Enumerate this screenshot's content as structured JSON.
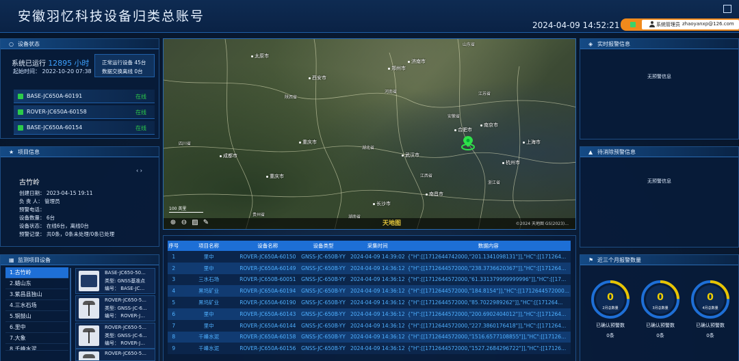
{
  "header": {
    "title": "安徽羽忆科技设备归类总账号",
    "datetime": "2024-04-09 14:52:21",
    "user_role": "系统管理员",
    "user_email": "zhaoyanxp@126.com"
  },
  "device_status": {
    "title": "设备状态",
    "running_label": "系统已运行",
    "running_hours": "12895",
    "running_unit": "小时",
    "start_label": "起始时间：",
    "start_value": "2022-10-20 07:38",
    "normal_label": "正常运行设备 45台",
    "offline_label": "数据交换离线 0台",
    "devices": [
      {
        "name": "BASE-JC650A-60191",
        "status": "在线"
      },
      {
        "name": "ROVER-JC650A-60158",
        "status": "在线"
      },
      {
        "name": "BASE-JC650A-60154",
        "status": "在线"
      }
    ]
  },
  "project_info": {
    "title": "项目信息",
    "name": "古竹岭",
    "create_date": "创建日期：  2023-04-15 19:11",
    "owner": "负 责 人：  管理员",
    "phone": "预警电话：",
    "device_count": "设备数量：  6台",
    "device_status": "设备状态：  在线6台，离线0台",
    "alarm_record": "预警记录：  共0条，0条未处理/0条已处理"
  },
  "monitor": {
    "title": "监测项目设备",
    "items": [
      "1.古竹岭",
      "2.蜡山东",
      "3.紫昌县独山",
      "4.三水石场",
      "5.铜鼓山",
      "6.里中",
      "7.大象",
      "8.千峰水泥"
    ],
    "cards": [
      {
        "name": "BASE-JC650-50...",
        "type": "类型: GNSS基准点",
        "code": "编号：  BASE-JC..."
      },
      {
        "name": "ROVER-JC650-5...",
        "type": "类型: GNSS-JC-6...",
        "code": "编号：  ROVER-J..."
      },
      {
        "name": "ROVER-JC650-5...",
        "type": "类型: GNSS-JC-6...",
        "code": "编号：  ROVER-J..."
      },
      {
        "name": "ROVER-JC650-5...",
        "type": "",
        "code": ""
      }
    ]
  },
  "map": {
    "scale": "100 英里",
    "logo": "天地图",
    "copyright": "©2024 天地图 GS(2023)...",
    "cities": [
      "郑州市",
      "西安市",
      "合肥市",
      "南京市",
      "上海市",
      "武汉市",
      "成都市",
      "重庆市",
      "杭州市",
      "长沙市",
      "南昌市",
      "太原市",
      "济南市"
    ],
    "provinces": [
      "河南省",
      "陕西省",
      "湖北省",
      "安徽省",
      "江苏省",
      "四川省",
      "重庆市",
      "湖南省",
      "江西省",
      "浙江省",
      "贵州省",
      "山东省"
    ]
  },
  "table": {
    "headers": [
      "序号",
      "项目名称",
      "设备名称",
      "设备类型",
      "采集时间",
      "数据内容"
    ],
    "rows": [
      [
        "1",
        "里中",
        "ROVER-JC650A-60150",
        "GNSS-JC-650B-YY",
        "2024-04-09 14:39:02",
        "{\"H\":[[1712644742000,\"201.1341098131\"]],\"HC\":[[171264..."
      ],
      [
        "2",
        "里中",
        "ROVER-JC650A-60149",
        "GNSS-JC-650B-YY",
        "2024-04-09 14:36:12",
        "{\"H\":[[1712644572000,\"238.3736620367\"]],\"HC\":[[171264..."
      ],
      [
        "3",
        "三水石场",
        "ROVER-JC650B-60051",
        "GNSS-JC-650B-YY",
        "2024-04-09 14:36:12",
        "{\"H\":[[1712644572000,\"61.331379999999996\"]],\"HC\":[[17..."
      ],
      [
        "4",
        "黑坞矿业",
        "ROVER-JC650A-60194",
        "GNSS-JC-650B-YY",
        "2024-04-09 14:36:12",
        "{\"H\":[[1712644572000,\"184.8154\"]],\"HC\":[[1712644572000..."
      ],
      [
        "5",
        "黑坞矿业",
        "ROVER-JC650A-60190",
        "GNSS-JC-650B-YY",
        "2024-04-09 14:36:12",
        "{\"H\":[[1712644572000,\"85.7022989262\"]],\"HC\":[[171264..."
      ],
      [
        "6",
        "里中",
        "ROVER-JC650A-60143",
        "GNSS-JC-650B-YY",
        "2024-04-09 14:36:12",
        "{\"H\":[[1712644572000,\"200.6902404012\"]],\"HC\":[[171264..."
      ],
      [
        "7",
        "里中",
        "ROVER-JC650A-60144",
        "GNSS-JC-650B-YY",
        "2024-04-09 14:36:12",
        "{\"H\":[[1712644572000,\"227.3860176418\"]],\"HC\":[[171264..."
      ],
      [
        "8",
        "千峰水泥",
        "ROVER-JC650A-60158",
        "GNSS-JC-650B-YY",
        "2024-04-09 14:36:12",
        "{\"H\":[[1712644572000,\"1516.6577108855\"]],\"HC\":[[17126..."
      ],
      [
        "9",
        "千峰水泥",
        "ROVER-JC650A-60156",
        "GNSS-JC-650B-YY",
        "2024-04-09 14:36:12",
        "{\"H\":[[1712644572000,\"1527.2684296722\"]],\"HC\":[[17126..."
      ]
    ]
  },
  "realtime_alarm": {
    "title": "实时报警信息",
    "empty": "无预警信息"
  },
  "pending_alarm": {
    "title": "待消除预警信息",
    "empty": "无预警信息"
  },
  "three_month": {
    "title": "近三个月报警数量",
    "rings": [
      {
        "value": "0",
        "sub": "2月总数量",
        "label": "已确认预警数",
        "count": "0条"
      },
      {
        "value": "0",
        "sub": "3月总数量",
        "label": "已确认预警数",
        "count": "0条"
      },
      {
        "value": "0",
        "sub": "4月总数量",
        "label": "已确认预警数",
        "count": "0条"
      }
    ]
  },
  "colors": {
    "accent": "#1e6fd6",
    "online": "#2ccb4a",
    "warning": "#f08a1c",
    "ring_yellow": "#f0d000"
  }
}
